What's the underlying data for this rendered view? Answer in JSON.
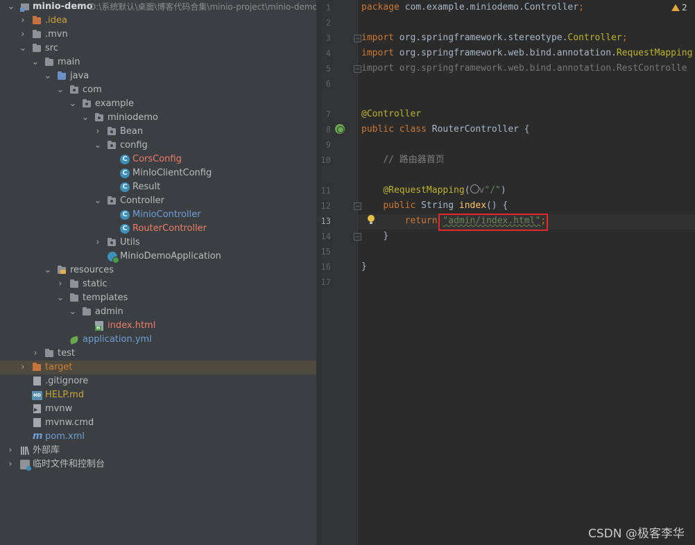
{
  "project_tree": {
    "root": {
      "name": "minio-demo",
      "path": "D:\\系统默认\\桌面\\博客代码合集\\minio-project\\minio-demo"
    },
    "items": [
      {
        "label": ".idea"
      },
      {
        "label": ".mvn"
      },
      {
        "label": "src"
      },
      {
        "label": "main"
      },
      {
        "label": "java"
      },
      {
        "label": "com"
      },
      {
        "label": "example"
      },
      {
        "label": "miniodemo"
      },
      {
        "label": "Bean"
      },
      {
        "label": "config"
      },
      {
        "label": "CorsConfig"
      },
      {
        "label": "MinIoClientConfig"
      },
      {
        "label": "Result"
      },
      {
        "label": "Controller"
      },
      {
        "label": "MinioController"
      },
      {
        "label": "RouterController"
      },
      {
        "label": "Utils"
      },
      {
        "label": "MinioDemoApplication"
      },
      {
        "label": "resources"
      },
      {
        "label": "static"
      },
      {
        "label": "templates"
      },
      {
        "label": "admin"
      },
      {
        "label": "index.html"
      },
      {
        "label": "application.yml"
      },
      {
        "label": "test"
      },
      {
        "label": "target"
      },
      {
        "label": ".gitignore"
      },
      {
        "label": "HELP.md"
      },
      {
        "label": "mvnw"
      },
      {
        "label": "mvnw.cmd"
      },
      {
        "label": "pom.xml"
      },
      {
        "label": "外部库"
      },
      {
        "label": "临时文件和控制台"
      }
    ],
    "class_icon_letter": "C"
  },
  "editor": {
    "line_numbers": [
      "1",
      "2",
      "3",
      "4",
      "5",
      "6",
      "7",
      "8",
      "9",
      "10",
      "11",
      "12",
      "13",
      "14",
      "15",
      "16",
      "17"
    ],
    "current_line": "13",
    "warnings": "2",
    "code": {
      "l1_kw": "package",
      "l1_rest": " com.example.miniodemo.Controller",
      "l1_semi": ";",
      "l3_kw": "import",
      "l3_pkg": " org.springframework.stereotype.",
      "l3_ann": "Controller",
      "l3_semi": ";",
      "l4_kw": "import",
      "l4_pkg": " org.springframework.web.bind.annotation.",
      "l4_ann": "RequestMapping",
      "l5_text": "import org.springframework.web.bind.annotation.RestControlle",
      "l7_ann": "@Controller",
      "l8_kw": "public class",
      "l8_rest": " RouterController {",
      "l10_cmt": "// 路由器首页",
      "l11_ann": "@RequestMapping",
      "l11_open": "(",
      "l11_chev": "v",
      "l11_str": "\"/\"",
      "l11_close": ")",
      "l12_kw": "public",
      "l12_type": " String ",
      "l12_meth": "index",
      "l12_rest": "() {",
      "l13_kw": "return",
      "l13_str": "\"admin/index.html\"",
      "l13_semi": ";",
      "l14_close": "}",
      "l16_close": "}"
    }
  },
  "watermark": "CSDN @极客李华",
  "colors": {
    "keyword": "#cc7832",
    "annotation": "#bbb529",
    "string": "#6a8759",
    "comment": "#808080",
    "method": "#ffc66d",
    "highlight_box": "#e52a2a"
  }
}
